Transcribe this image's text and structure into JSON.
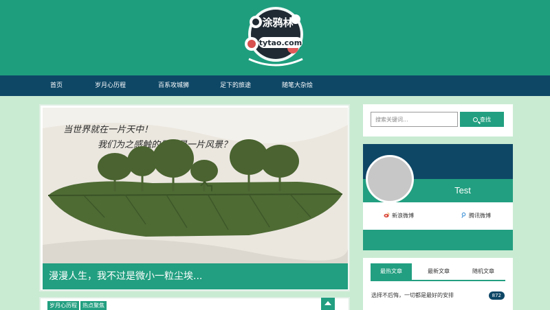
{
  "header": {
    "logo": {
      "title_text": "涂鸦林",
      "domain_text": "tytao.com"
    }
  },
  "nav": {
    "items": [
      {
        "label": "首页"
      },
      {
        "label": "岁月心历程"
      },
      {
        "label": "百系攻城狮"
      },
      {
        "label": "足下的旅途"
      },
      {
        "label": "随笔大杂烩"
      }
    ]
  },
  "main": {
    "featured": {
      "title": "漫漫人生，我不过是微小一粒尘埃...",
      "image_caption_line1": "当世界就在一片天中！",
      "image_caption_line2": "我们为之感触的是不是一片风景？"
    },
    "next_post": {
      "tags": [
        "岁月心历程",
        "热点聚焦"
      ]
    }
  },
  "sidebar": {
    "search": {
      "placeholder": "搜索关键词...",
      "button_label": "查找"
    },
    "profile": {
      "name": "Test",
      "weibo_label": "新浪微博",
      "tencent_label": "腾讯微博"
    },
    "articles": {
      "tabs": [
        "最热文章",
        "最新文章",
        "随机文章"
      ],
      "active_tab": "最热文章",
      "items": [
        {
          "title": "选择不后悔，一切都是最好的安排",
          "count": "872"
        }
      ]
    }
  },
  "colors": {
    "primary_green": "#229f80",
    "dark_navy": "#0e4766",
    "page_background": "#c9ebd2",
    "header_green": "#1f9e7e"
  }
}
